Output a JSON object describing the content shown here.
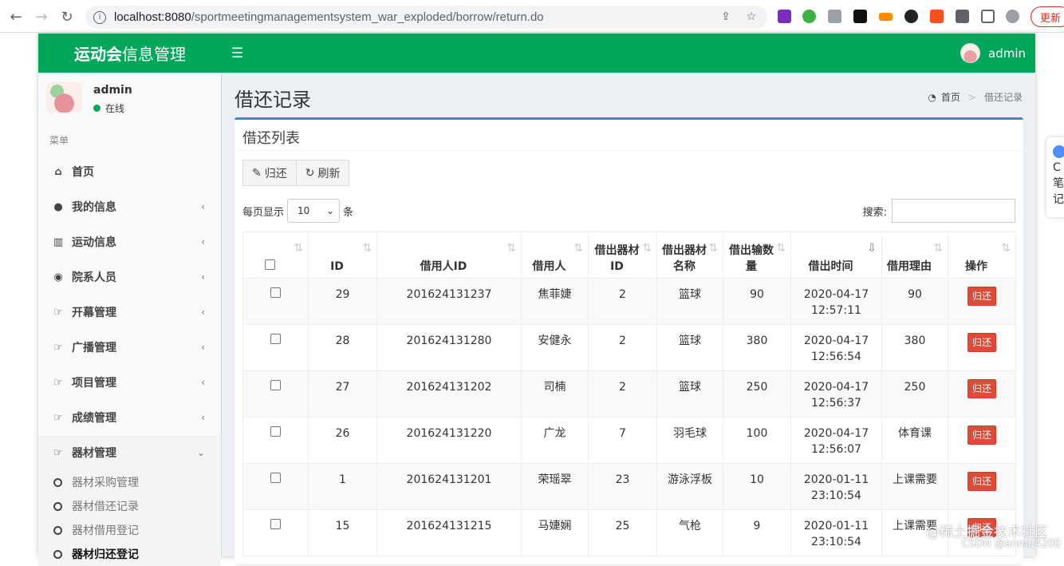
{
  "browser": {
    "url_host": "localhost:8080",
    "url_path": "/sportmeetingmanagementsystem_war_exploded/borrow/return.do",
    "update_label": "更新"
  },
  "app": {
    "logo_bold": "运动会",
    "logo_rest": "信息管理",
    "top_user": "admin"
  },
  "sidebar": {
    "user_name": "admin",
    "status": "在线",
    "menu_header": "菜单",
    "items": [
      {
        "label": "首页",
        "icon": "home-icon",
        "glyph": "⌂",
        "chevron": ""
      },
      {
        "label": "我的信息",
        "icon": "user-icon",
        "glyph": "●",
        "chevron": "‹"
      },
      {
        "label": "运动信息",
        "icon": "bar-chart-icon",
        "glyph": "▥",
        "chevron": "‹"
      },
      {
        "label": "院系人员",
        "icon": "users-icon",
        "glyph": "◉",
        "chevron": "‹"
      },
      {
        "label": "开幕管理",
        "icon": "hand-point-icon",
        "glyph": "☞",
        "chevron": "‹"
      },
      {
        "label": "广播管理",
        "icon": "hand-point-icon",
        "glyph": "☞",
        "chevron": "‹"
      },
      {
        "label": "项目管理",
        "icon": "hand-point-icon",
        "glyph": "☞",
        "chevron": "‹"
      },
      {
        "label": "成绩管理",
        "icon": "hand-point-icon",
        "glyph": "☞",
        "chevron": "‹"
      },
      {
        "label": "器材管理",
        "icon": "hand-point-icon",
        "glyph": "☞",
        "chevron": "⌄"
      }
    ],
    "subitems": [
      {
        "label": "器材采购管理"
      },
      {
        "label": "器材借还记录"
      },
      {
        "label": "器材借用登记"
      },
      {
        "label": "器材归还登记"
      }
    ]
  },
  "content": {
    "page_title": "借还记录",
    "crumb_home": "首页",
    "crumb_current": "借还记录",
    "box_title": "借还列表",
    "btn_return": "归还",
    "btn_refresh": "刷新",
    "len_prefix": "每页显示",
    "len_value": "10",
    "len_suffix": "条",
    "search_label": "搜索:"
  },
  "table": {
    "headers": [
      "",
      "ID",
      "借用人ID",
      "借用人",
      "借出器材ID",
      "借出器材名称",
      "借出输数量",
      "借出时间",
      "借用理由",
      "操作"
    ],
    "action_label": "归还",
    "rows": [
      {
        "id": "29",
        "uid": "201624131237",
        "name": "焦菲婕",
        "eid": "2",
        "ename": "篮球",
        "qty": "90",
        "date": "2020-04-17",
        "time": "12:57:11",
        "reason": "90"
      },
      {
        "id": "28",
        "uid": "201624131280",
        "name": "安健永",
        "eid": "2",
        "ename": "篮球",
        "qty": "380",
        "date": "2020-04-17",
        "time": "12:56:54",
        "reason": "380"
      },
      {
        "id": "27",
        "uid": "201624131202",
        "name": "司楠",
        "eid": "2",
        "ename": "篮球",
        "qty": "250",
        "date": "2020-04-17",
        "time": "12:56:37",
        "reason": "250"
      },
      {
        "id": "26",
        "uid": "201624131220",
        "name": "广龙",
        "eid": "7",
        "ename": "羽毛球",
        "qty": "100",
        "date": "2020-04-17",
        "time": "12:56:07",
        "reason": "体育课"
      },
      {
        "id": "1",
        "uid": "201624131201",
        "name": "荣瑶翠",
        "eid": "23",
        "ename": "游泳浮板",
        "qty": "10",
        "date": "2020-01-11",
        "time": "23:10:54",
        "reason": "上课需要"
      },
      {
        "id": "15",
        "uid": "201624131215",
        "name": "马婕娴",
        "eid": "25",
        "ename": "气枪",
        "qty": "9",
        "date": "2020-01-11",
        "time": "23:10:54",
        "reason": "上课需要"
      }
    ]
  },
  "overlay": {
    "side_pop_lines": [
      "C",
      "笔",
      "记"
    ],
    "watermark": "@稀土掘金技术社区",
    "watermark2": "CSDN @anmu4200"
  }
}
